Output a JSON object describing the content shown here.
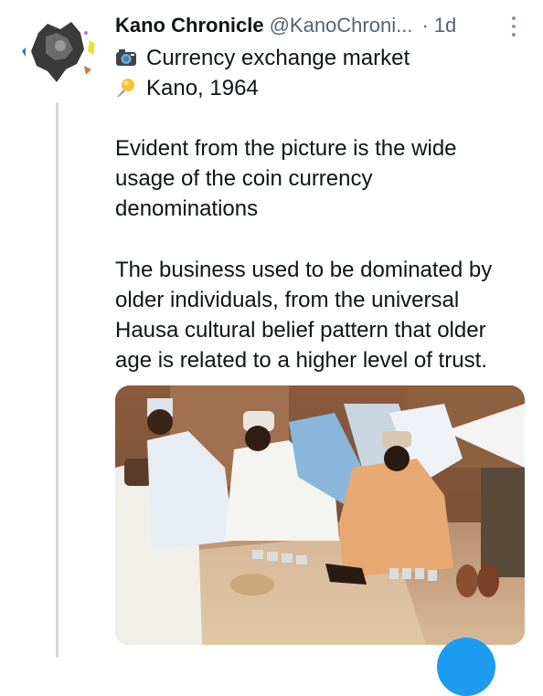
{
  "tweet": {
    "author_name": "Kano Chronicle",
    "handle": "@KanoChroni...",
    "separator": "·",
    "time": "1d",
    "line1_icon": "camera-icon",
    "line1_text": "Currency exchange market",
    "line2_icon": "pushpin-icon",
    "line2_text": "Kano, 1964",
    "paragraph1": [
      "Evident from the picture is the wide",
      "usage of the coin currency",
      "denominations"
    ],
    "paragraph2": [
      "The business used to be dominated by",
      "older individuals, from the universal",
      "Hausa cultural belief pattern that older",
      "age is related to a higher level of trust."
    ]
  },
  "colors": {
    "text": "#0f1419",
    "muted": "#536471",
    "thread_line": "#cfd9de",
    "accent": "#1d9bf0"
  }
}
